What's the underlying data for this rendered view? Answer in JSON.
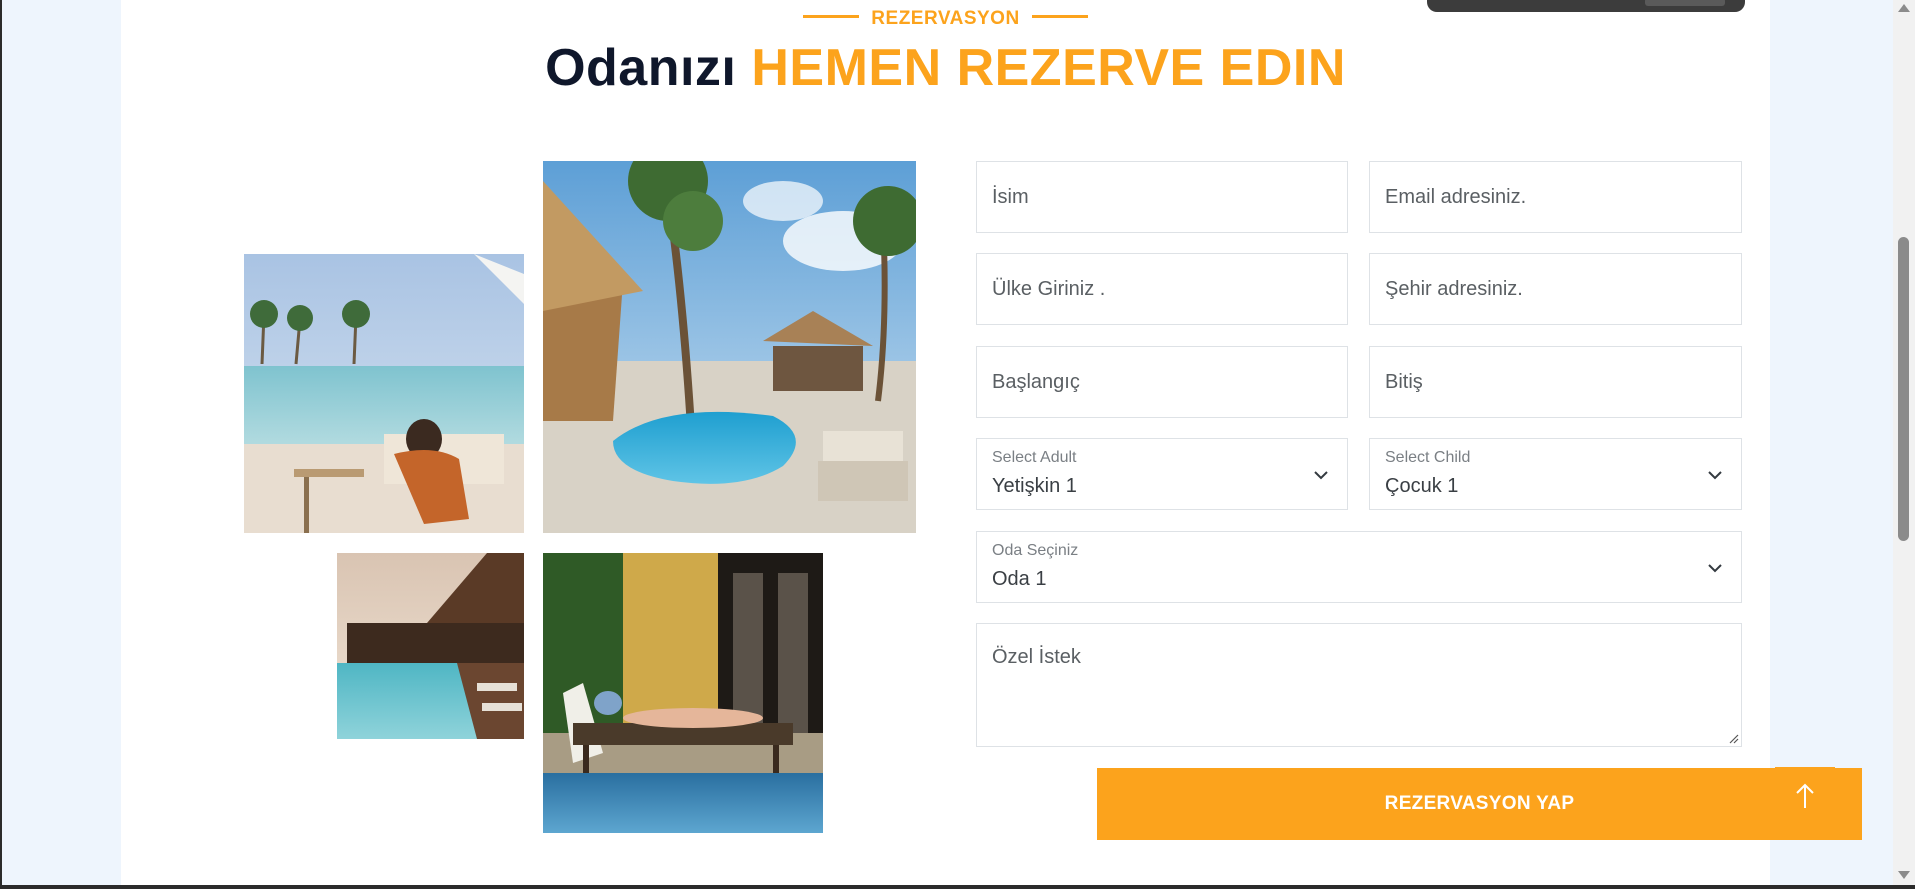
{
  "section": {
    "eyebrow": "REZERVASYON",
    "title_part1": "Odanızı",
    "title_part2": "HEMEN REZERVE EDIN"
  },
  "form": {
    "name_placeholder": "İsim",
    "email_placeholder": "Email adresiniz.",
    "country_placeholder": "Ülke Giriniz .",
    "city_placeholder": "Şehir adresiniz.",
    "start_placeholder": "Başlangıç",
    "end_placeholder": "Bitiş",
    "adult": {
      "label": "Select Adult",
      "value": "Yetişkin 1"
    },
    "child": {
      "label": "Select Child",
      "value": "Çocuk 1"
    },
    "room": {
      "label": "Oda Seçiniz",
      "value": "Oda 1"
    },
    "notes_placeholder": "Özel İstek",
    "submit_label": "REZERVASYON YAP"
  },
  "images": [
    "pool-lounge-photo",
    "tropical-resort-photo",
    "waterfront-lodge-photo",
    "sunbathing-poolside-photo"
  ],
  "colors": {
    "accent": "#fca31c",
    "heading": "#0f172b",
    "border": "#dee2e6"
  }
}
